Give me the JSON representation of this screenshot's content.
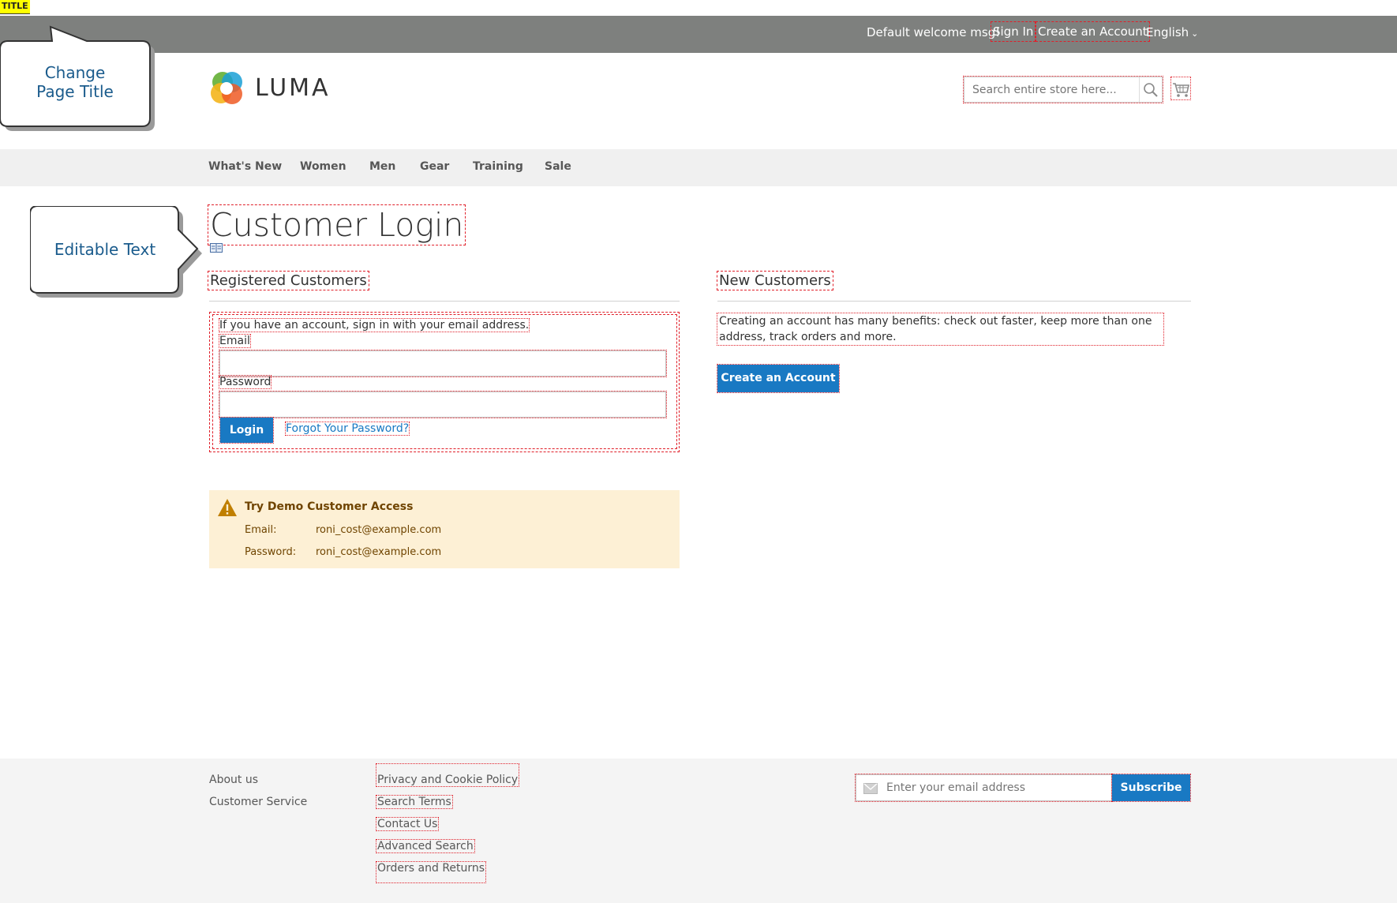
{
  "title_badge": "TITLE",
  "topbar": {
    "welcome": "Default welcome msg!",
    "sign_in": "Sign In",
    "create_account": "Create an Account",
    "language": "English"
  },
  "header": {
    "logo_text": "LUMA",
    "search_placeholder": "Search entire store here..."
  },
  "nav": {
    "items": [
      "What's New",
      "Women",
      "Men",
      "Gear",
      "Training",
      "Sale"
    ]
  },
  "callouts": {
    "change_page_title_line1": "Change",
    "change_page_title_line2": "Page Title",
    "editable_text": "Editable Text"
  },
  "page_title": "Customer Login",
  "registered": {
    "heading": "Registered Customers",
    "intro": "If you have an account, sign in with your email address.",
    "email_label": "Email",
    "password_label": "Password",
    "login_button": "Login",
    "forgot_link": "Forgot Your Password?"
  },
  "demo": {
    "title": "Try Demo Customer Access",
    "email_label": "Email:",
    "email_value": "roni_cost@example.com",
    "password_label": "Password:",
    "password_value": "roni_cost@example.com"
  },
  "new_customers": {
    "heading": "New Customers",
    "text": "Creating an account has many benefits: check out faster, keep more than one address, track orders and more.",
    "button": "Create an Account"
  },
  "footer": {
    "col1": [
      "About us",
      "Customer Service"
    ],
    "col2": [
      "Privacy and Cookie Policy",
      "Search Terms",
      "Contact Us",
      "Advanced Search",
      "Orders and Returns"
    ],
    "newsletter_placeholder": "Enter your email address",
    "subscribe": "Subscribe"
  },
  "colors": {
    "topbar": "#7e807e",
    "primary": "#1979c3",
    "demo_bg": "#fdf0d5",
    "outline": "#e0202a"
  }
}
